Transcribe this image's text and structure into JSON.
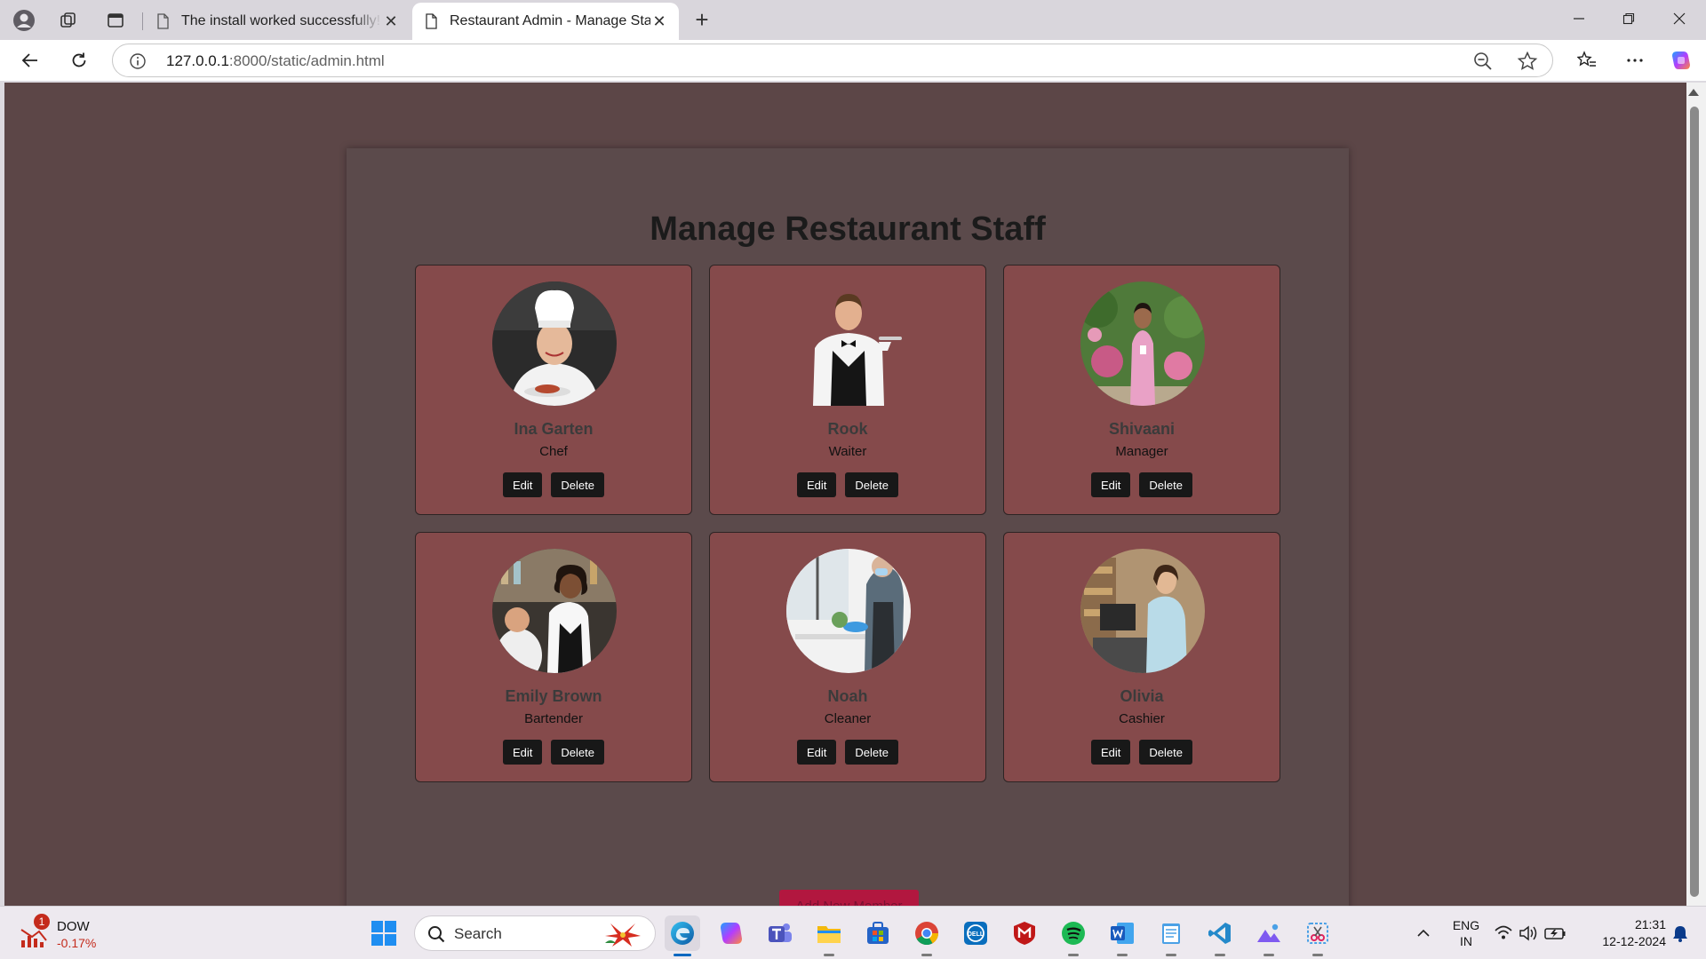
{
  "browser": {
    "tabs": [
      {
        "title": "The install worked successfully! Congratulations!",
        "active": false
      },
      {
        "title": "Restaurant Admin - Manage Staff",
        "active": true
      }
    ],
    "address": {
      "host": "127.0.0.1",
      "path": ":8000/static/admin.html"
    }
  },
  "page": {
    "title": "Manage Restaurant Staff",
    "add_button_label": "Add New Member",
    "staff": [
      {
        "name": "Ina Garten",
        "role": "Chef",
        "edit_label": "Edit",
        "delete_label": "Delete"
      },
      {
        "name": "Rook",
        "role": "Waiter",
        "edit_label": "Edit",
        "delete_label": "Delete"
      },
      {
        "name": "Shivaani",
        "role": "Manager",
        "edit_label": "Edit",
        "delete_label": "Delete"
      },
      {
        "name": "Emily Brown",
        "role": "Bartender",
        "edit_label": "Edit",
        "delete_label": "Delete"
      },
      {
        "name": "Noah",
        "role": "Cleaner",
        "edit_label": "Edit",
        "delete_label": "Delete"
      },
      {
        "name": "Olivia",
        "role": "Cashier",
        "edit_label": "Edit",
        "delete_label": "Delete"
      }
    ]
  },
  "taskbar": {
    "stock": {
      "ticker": "DOW",
      "change": "-0.17%",
      "badge": "1"
    },
    "search_label": "Search",
    "lang_line1": "ENG",
    "lang_line2": "IN",
    "time": "21:31",
    "date": "12-12-2024"
  },
  "colors": {
    "page_background": "#5c4647",
    "panel": "#5b4a4b",
    "card": "#854a4b",
    "button": "#181818",
    "add_button": "#b2173f"
  }
}
